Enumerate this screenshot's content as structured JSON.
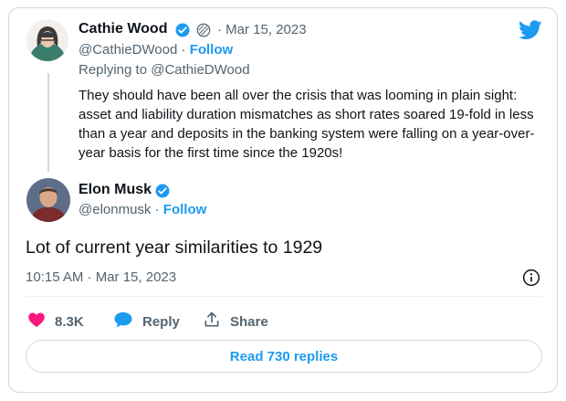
{
  "reply_tweet": {
    "author_name": "Cathie Wood",
    "date": "Mar 15, 2023",
    "handle": "@CathieDWood",
    "follow_label": "Follow",
    "replying_to": "Replying to @CathieDWood",
    "text": "They should have been all over the crisis that was looming in plain sight: asset and liability duration mismatches as short rates soared 19-fold in less than a year and deposits in the banking system were falling on a year-over-year basis for the first time since the 1920s!"
  },
  "main_tweet": {
    "author_name": "Elon Musk",
    "handle": "@elonmusk",
    "follow_label": "Follow",
    "text": "Lot of current year similarities to 1929",
    "timestamp": "10:15 AM · Mar 15, 2023"
  },
  "actions": {
    "like_count": "8.3K",
    "reply_label": "Reply",
    "share_label": "Share"
  },
  "read_replies_label": "Read 730 replies",
  "colors": {
    "accent": "#1d9bf0",
    "like": "#f91880",
    "muted": "#536471",
    "border": "#cfd9de"
  },
  "icons": [
    "twitter-logo-icon",
    "verified-icon",
    "info-icon",
    "heart-icon",
    "reply-bubble-icon",
    "share-icon"
  ]
}
